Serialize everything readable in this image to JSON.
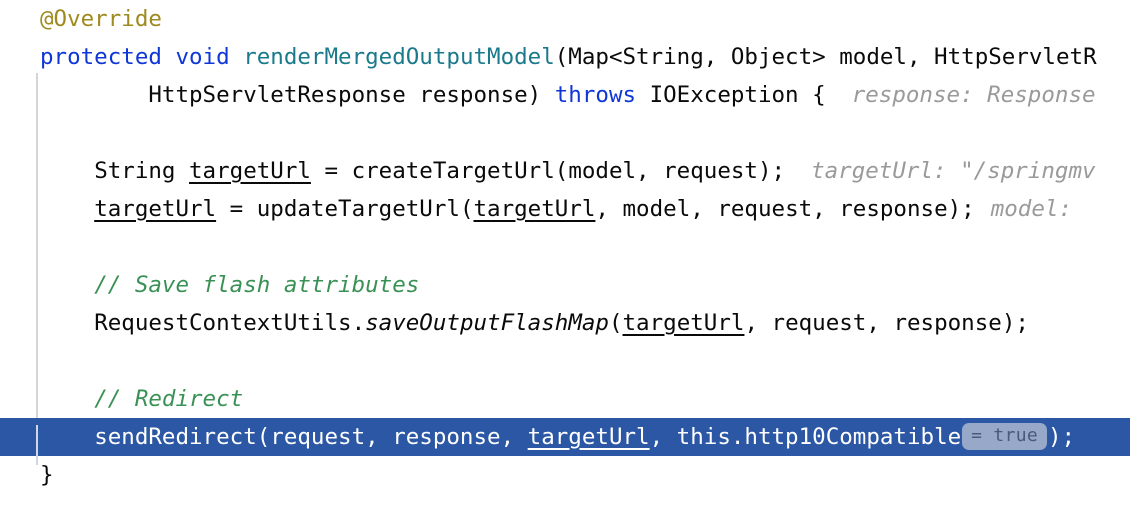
{
  "editor": {
    "language": "java",
    "theme": "light",
    "colors": {
      "background": "#ffffff",
      "default_text": "#0a0a0a",
      "keyword": "#0f36d6",
      "annotation": "#9e8a1e",
      "method_declaration": "#1a7a8c",
      "comment": "#3a9155",
      "inlay_hint": "#9a9a9a",
      "selected_line_bg": "#2b57a4",
      "selected_line_text": "#ffffff",
      "inlay_badge_bg": "#97a8c9",
      "inlay_badge_text": "#4a5b78",
      "indent_guide": "#d5d5d5"
    },
    "lines": [
      {
        "id": "line-annotation-override",
        "indent": "",
        "tokens": [
          {
            "kind": "annotation",
            "text": "@Override"
          }
        ]
      },
      {
        "id": "line-method-signature",
        "indent": "",
        "tokens": [
          {
            "kind": "keyword",
            "text": "protected"
          },
          {
            "kind": "plain",
            "text": " "
          },
          {
            "kind": "keyword",
            "text": "void"
          },
          {
            "kind": "plain",
            "text": " "
          },
          {
            "kind": "method",
            "text": "renderMergedOutputModel"
          },
          {
            "kind": "plain",
            "text": "(Map<String, Object> model, HttpServletR"
          }
        ]
      },
      {
        "id": "line-signature-continuation",
        "indent": "        ",
        "tokens": [
          {
            "kind": "plain",
            "text": "HttpServletResponse response) "
          },
          {
            "kind": "keyword",
            "text": "throws"
          },
          {
            "kind": "plain",
            "text": " IOException {"
          },
          {
            "kind": "gap",
            "text": ""
          },
          {
            "kind": "hint",
            "text": "response: Response"
          }
        ]
      },
      {
        "id": "line-blank-1",
        "indent": "",
        "tokens": []
      },
      {
        "id": "line-create-target-url",
        "indent": "    ",
        "tokens": [
          {
            "kind": "plain",
            "text": "String "
          },
          {
            "kind": "underline",
            "text": "targetUrl"
          },
          {
            "kind": "plain",
            "text": " = createTargetUrl(model, request);"
          },
          {
            "kind": "gap",
            "text": ""
          },
          {
            "kind": "hint",
            "text": "targetUrl: \"/springmv"
          }
        ]
      },
      {
        "id": "line-update-target-url",
        "indent": "    ",
        "tokens": [
          {
            "kind": "underline",
            "text": "targetUrl"
          },
          {
            "kind": "plain",
            "text": " = updateTargetUrl("
          },
          {
            "kind": "underline",
            "text": "targetUrl"
          },
          {
            "kind": "plain",
            "text": ", model, request, response);"
          },
          {
            "kind": "gap-sm",
            "text": ""
          },
          {
            "kind": "hint",
            "text": "model:"
          }
        ]
      },
      {
        "id": "line-blank-2",
        "indent": "",
        "tokens": []
      },
      {
        "id": "line-comment-save-flash",
        "indent": "    ",
        "tokens": [
          {
            "kind": "comment",
            "text": "// Save flash attributes"
          }
        ]
      },
      {
        "id": "line-save-output-flashmap",
        "indent": "    ",
        "tokens": [
          {
            "kind": "plain",
            "text": "RequestContextUtils."
          },
          {
            "kind": "static",
            "text": "saveOutputFlashMap"
          },
          {
            "kind": "plain",
            "text": "("
          },
          {
            "kind": "underline",
            "text": "targetUrl"
          },
          {
            "kind": "plain",
            "text": ", request, response);"
          }
        ]
      },
      {
        "id": "line-blank-3",
        "indent": "",
        "tokens": []
      },
      {
        "id": "line-comment-redirect",
        "indent": "    ",
        "tokens": [
          {
            "kind": "comment",
            "text": "// Redirect"
          }
        ]
      },
      {
        "id": "line-send-redirect",
        "selected": true,
        "indent": "    ",
        "tokens": [
          {
            "kind": "plain",
            "text": "sendRedirect(request, response, "
          },
          {
            "kind": "underline",
            "text": "targetUrl"
          },
          {
            "kind": "plain",
            "text": ", this.http10Compatible"
          },
          {
            "kind": "badge",
            "text": "= true"
          },
          {
            "kind": "plain",
            "text": ");"
          }
        ]
      },
      {
        "id": "line-closing-brace",
        "indent": "",
        "tokens": [
          {
            "kind": "plain",
            "text": "}"
          }
        ]
      }
    ]
  }
}
